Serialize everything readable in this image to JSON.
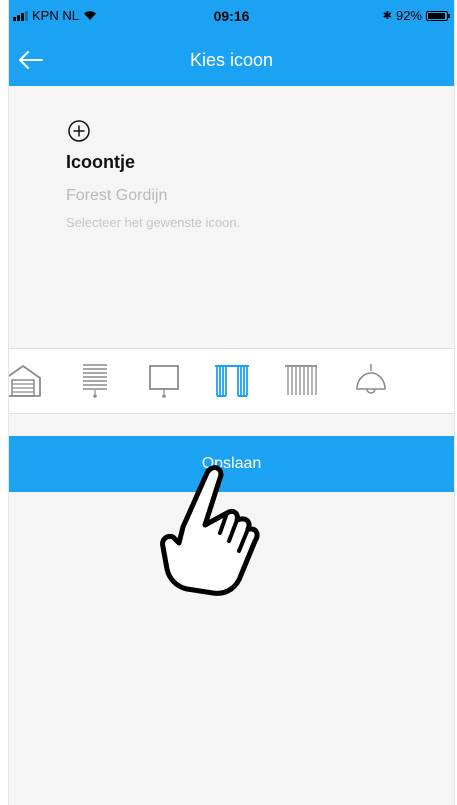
{
  "statusbar": {
    "carrier": "KPN NL",
    "time": "09:16",
    "bluetooth": "✱",
    "battery_text": "92%",
    "battery_level": 0.92
  },
  "navbar": {
    "back_icon": "arrow-left-icon",
    "title": "Kies icoon"
  },
  "info": {
    "add_icon": "plus-circle-icon",
    "title": "Icoontje",
    "device_name": "Forest Gordijn",
    "hint": "Selecteer het gewenste icoon."
  },
  "icon_options": [
    {
      "icon": "garage-icon",
      "selected": false
    },
    {
      "icon": "roller-blind-icon",
      "selected": false
    },
    {
      "icon": "screen-icon",
      "selected": false
    },
    {
      "icon": "curtain-icon",
      "selected": true
    },
    {
      "icon": "vertical-blind-icon",
      "selected": false
    },
    {
      "icon": "lamp-icon",
      "selected": false
    }
  ],
  "save_button": {
    "label": "Opslaan"
  },
  "overlay": {
    "icon": "pointing-hand-icon"
  },
  "colors": {
    "accent": "#1ba2f3",
    "icon_gray": "#8a8a8a",
    "background": "#f5f5f5"
  }
}
